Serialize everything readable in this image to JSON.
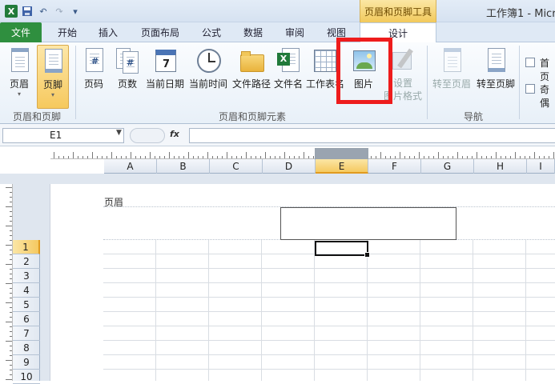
{
  "window": {
    "title": "工作簿1 - Micr"
  },
  "context_tab_group": "页眉和页脚工具",
  "tabs": [
    {
      "label": "文件"
    },
    {
      "label": "开始"
    },
    {
      "label": "插入"
    },
    {
      "label": "页面布局"
    },
    {
      "label": "公式"
    },
    {
      "label": "数据"
    },
    {
      "label": "审阅"
    },
    {
      "label": "视图"
    },
    {
      "label": "设计"
    }
  ],
  "ribbon": {
    "group1": {
      "label": "页眉和页脚",
      "header": "页眉",
      "footer": "页脚"
    },
    "group2": {
      "label": "页眉和页脚元素",
      "page_number": "页码",
      "page_count": "页数",
      "current_date": "当前日期",
      "current_time": "当前时间",
      "file_path": "文件路径",
      "file_name": "文件名",
      "sheet_name": "工作表名",
      "picture": "图片",
      "format_picture_1": "设置",
      "format_picture_2": "图片格式"
    },
    "group3": {
      "label": "导航",
      "goto_header": "转至页眉",
      "goto_footer": "转至页脚"
    },
    "group4": {
      "first_page": "首页",
      "odd_even": "奇偶"
    }
  },
  "formula_bar": {
    "name_box": "E1",
    "fx": "fx",
    "formula": ""
  },
  "columns": [
    "A",
    "B",
    "C",
    "D",
    "E",
    "F",
    "G",
    "H",
    "I"
  ],
  "selected_column": "E",
  "rows": [
    "1",
    "2",
    "3",
    "4",
    "5",
    "6",
    "7",
    "8",
    "9",
    "10"
  ],
  "selected_row": "1",
  "page": {
    "header_label": "页眉"
  },
  "colors": {
    "file_tab": "#2f8f3f",
    "highlight": "#ee1c1c",
    "selection": "#f5c960"
  }
}
